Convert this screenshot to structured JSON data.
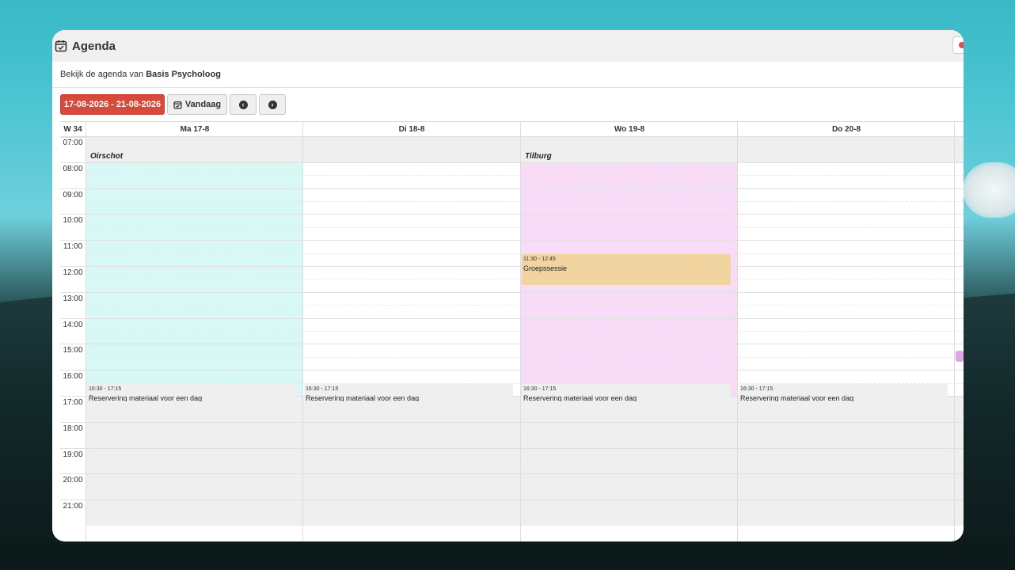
{
  "window": {
    "title": "Agenda"
  },
  "subtitle": {
    "prefix": "Bekijk de agenda van",
    "name": "Basis Psycholoog"
  },
  "toolbar": {
    "date_range": "17-08-2026 - 21-08-2026",
    "today_label": "Vandaag"
  },
  "calendar": {
    "week_label": "W 34",
    "days": [
      "Ma 17-8",
      "Di 18-8",
      "Wo 19-8",
      "Do 20-8"
    ],
    "hours": [
      "07:00",
      "08:00",
      "09:00",
      "10:00",
      "11:00",
      "12:00",
      "13:00",
      "14:00",
      "15:00",
      "16:00",
      "17:00",
      "18:00",
      "19:00",
      "20:00",
      "21:00"
    ],
    "locations": [
      {
        "day": "Ma 17-8",
        "name": "Oirschot",
        "color": "#d8f8f6"
      },
      {
        "day": "Wo 19-8",
        "name": "Tilburg",
        "color": "#f8dbf6"
      }
    ],
    "events": [
      {
        "day": "Wo 19-8",
        "time": "11:30 - 12:45",
        "title": "Groepssessie",
        "color": "#f1d49f"
      },
      {
        "day": "Ma 17-8",
        "time": "16:30 - 17:15",
        "title": "Reservering materiaal voor een dag",
        "color": "#efefef"
      },
      {
        "day": "Di 18-8",
        "time": "16:30 - 17:15",
        "title": "Reservering materiaal voor een dag",
        "color": "#efefef"
      },
      {
        "day": "Wo 19-8",
        "time": "16:30 - 17:15",
        "title": "Reservering materiaal voor een dag",
        "color": "#efefef"
      },
      {
        "day": "Do 20-8",
        "time": "16:30 - 17:15",
        "title": "Reservering materiaal voor een dag",
        "color": "#efefef"
      }
    ]
  }
}
